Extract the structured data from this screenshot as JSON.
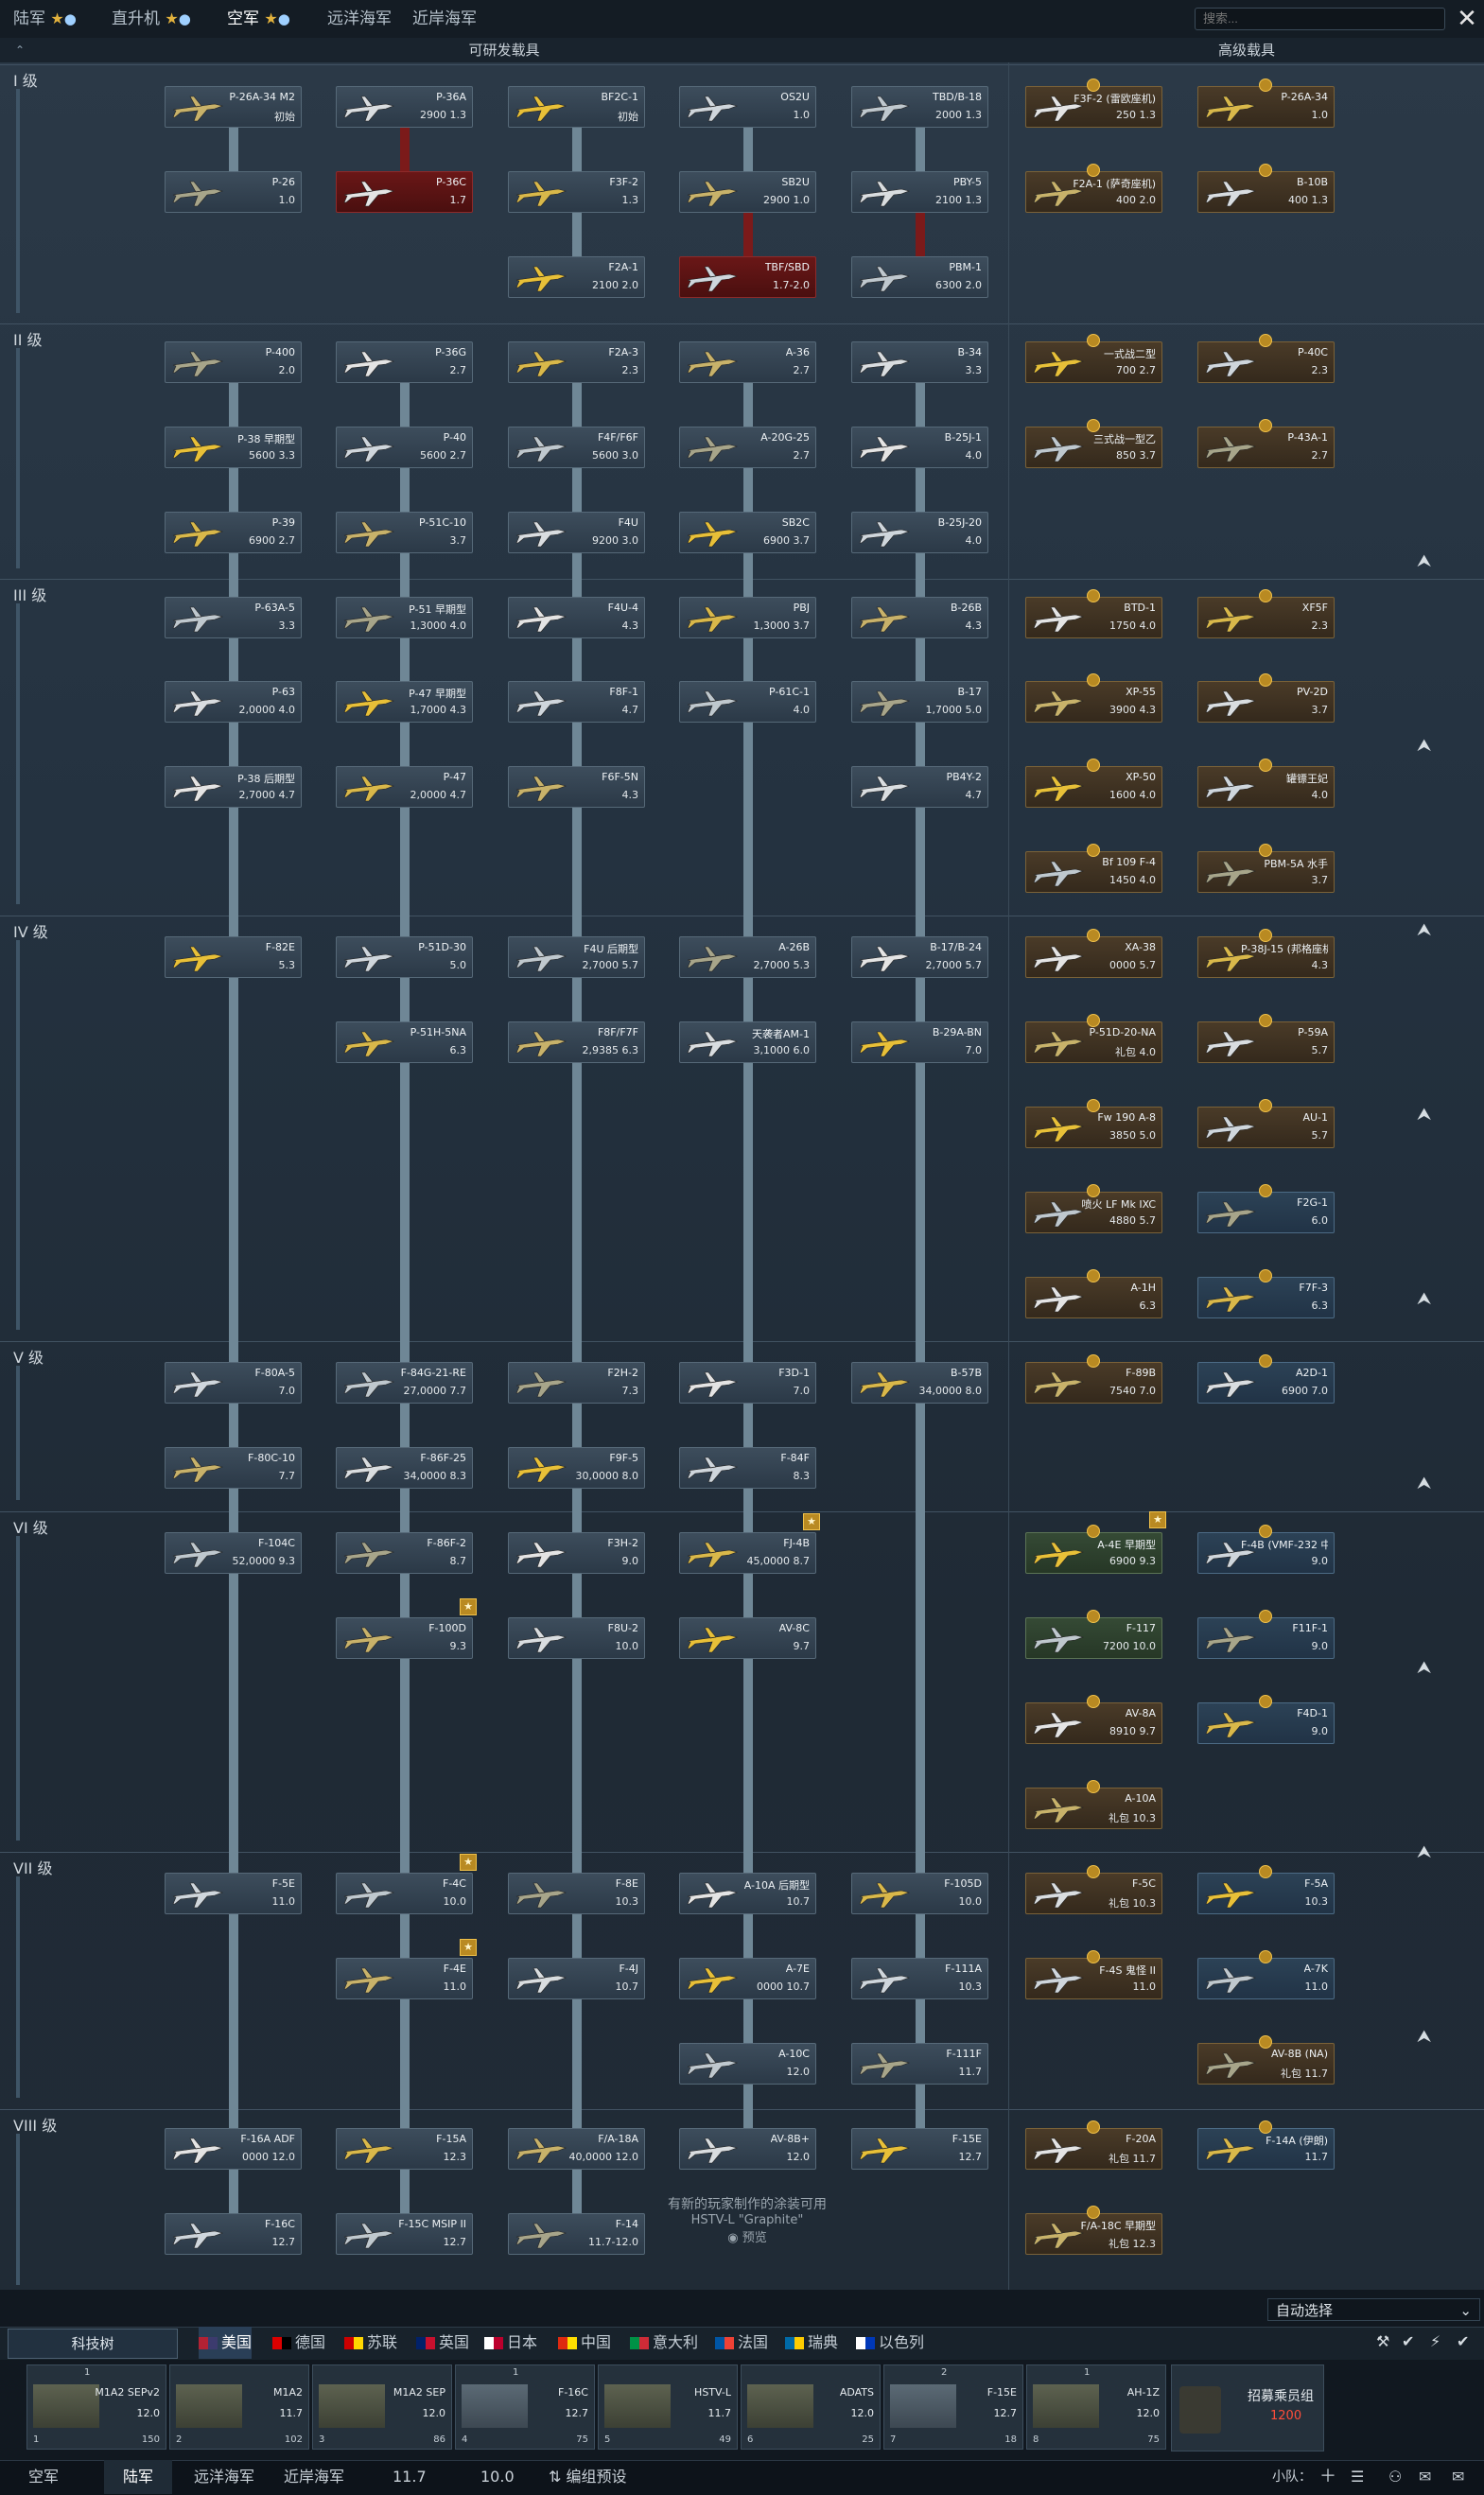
{
  "top_tabs": [
    {
      "label": "陆军",
      "stars": "★",
      "bulb": "💡"
    },
    {
      "label": "直升机",
      "stars": "★",
      "bulb": "💡"
    },
    {
      "label": "空军",
      "stars": "★",
      "bulb": "💡"
    },
    {
      "label": "远洋海军"
    },
    {
      "label": "近岸海军"
    }
  ],
  "search": {
    "placeholder": "搜索..."
  },
  "close_icon": "✕",
  "headers": {
    "researchable": "可研发载具",
    "premium": "高级载具"
  },
  "ranks": [
    "I 级",
    "II 级",
    "III 级",
    "IV 级",
    "V 级",
    "VI 级",
    "VII 级",
    "VIII 级"
  ],
  "vehicles": [
    {
      "name": "P-26A-34 M2",
      "br": "初始"
    },
    {
      "name": "P-36A",
      "br": "2900 1.3"
    },
    {
      "name": "BF2C-1",
      "br": "初始"
    },
    {
      "name": "OS2U",
      "br": "1.0"
    },
    {
      "name": "TBD/B-18",
      "br": "2000 1.3"
    },
    {
      "name": "P-26",
      "br": "1.0"
    },
    {
      "name": "P-36C",
      "br": "1.7"
    },
    {
      "name": "F3F-2",
      "br": "1.3"
    },
    {
      "name": "SB2U",
      "br": "2900 1.0"
    },
    {
      "name": "PBY-5",
      "br": "2100 1.3"
    },
    {
      "name": "F2A-1",
      "br": "2100 2.0"
    },
    {
      "name": "TBF/SBD",
      "br": "1.7-2.0"
    },
    {
      "name": "PBM-1",
      "br": "6300 2.0"
    },
    {
      "name": "P-400",
      "br": "2.0"
    },
    {
      "name": "P-36G",
      "br": "2.7"
    },
    {
      "name": "F2A-3",
      "br": "2.3"
    },
    {
      "name": "A-36",
      "br": "2.7"
    },
    {
      "name": "B-34",
      "br": "3.3"
    },
    {
      "name": "P-38 早期型",
      "br": "5600 3.3"
    },
    {
      "name": "P-40",
      "br": "5600 2.7"
    },
    {
      "name": "F4F/F6F",
      "br": "5600 3.0"
    },
    {
      "name": "A-20G-25",
      "br": "2.7"
    },
    {
      "name": "B-25J-1",
      "br": "4.0"
    },
    {
      "name": "P-39",
      "br": "6900 2.7"
    },
    {
      "name": "P-51C-10",
      "br": "3.7"
    },
    {
      "name": "F4U",
      "br": "9200 3.0"
    },
    {
      "name": "SB2C",
      "br": "6900 3.7"
    },
    {
      "name": "B-25J-20",
      "br": "4.0"
    },
    {
      "name": "P-63A-5",
      "br": "3.3"
    },
    {
      "name": "P-51 早期型",
      "br": "1,3000 4.0"
    },
    {
      "name": "F4U-4",
      "br": "4.3"
    },
    {
      "name": "PBJ",
      "br": "1,3000 3.7"
    },
    {
      "name": "B-26B",
      "br": "4.3"
    },
    {
      "name": "P-63",
      "br": "2,0000 4.0"
    },
    {
      "name": "P-47 早期型",
      "br": "1,7000 4.3"
    },
    {
      "name": "F8F-1",
      "br": "4.7"
    },
    {
      "name": "P-61C-1",
      "br": "4.0"
    },
    {
      "name": "B-17",
      "br": "1,7000 5.0"
    },
    {
      "name": "P-38 后期型",
      "br": "2,7000 4.7"
    },
    {
      "name": "P-47",
      "br": "2,0000 4.7"
    },
    {
      "name": "F6F-5N",
      "br": "4.3"
    },
    {
      "name": "PB4Y-2",
      "br": "4.7"
    },
    {
      "name": "F-82E",
      "br": "5.3"
    },
    {
      "name": "P-51D-30",
      "br": "5.0"
    },
    {
      "name": "F4U 后期型",
      "br": "2,7000 5.7"
    },
    {
      "name": "A-26B",
      "br": "2,7000 5.3"
    },
    {
      "name": "B-17/B-24",
      "br": "2,7000 5.7"
    },
    {
      "name": "P-51H-5NA",
      "br": "6.3"
    },
    {
      "name": "F8F/F7F",
      "br": "2,9385 6.3"
    },
    {
      "name": "天袭者AM-1",
      "br": "3,1000 6.0"
    },
    {
      "name": "B-29A-BN",
      "br": "7.0"
    },
    {
      "name": "F-80A-5",
      "br": "7.0"
    },
    {
      "name": "F-84G-21-RE",
      "br": "27,0000 7.7"
    },
    {
      "name": "F2H-2",
      "br": "7.3"
    },
    {
      "name": "F3D-1",
      "br": "7.0"
    },
    {
      "name": "B-57B",
      "br": "34,0000 8.0"
    },
    {
      "name": "F-80C-10",
      "br": "7.7"
    },
    {
      "name": "F-86F-25",
      "br": "34,0000 8.3"
    },
    {
      "name": "F9F-5",
      "br": "30,0000 8.0"
    },
    {
      "name": "F-84F",
      "br": "8.3"
    },
    {
      "name": "F-104C",
      "br": "52,0000 9.3"
    },
    {
      "name": "F-86F-2",
      "br": "8.7"
    },
    {
      "name": "F3H-2",
      "br": "9.0"
    },
    {
      "name": "FJ-4B",
      "br": "45,0000 8.7"
    },
    {
      "name": "F-100D",
      "br": "9.3"
    },
    {
      "name": "F8U-2",
      "br": "10.0"
    },
    {
      "name": "AV-8C",
      "br": "9.7"
    },
    {
      "name": "F-5E",
      "br": "11.0"
    },
    {
      "name": "F-4C",
      "br": "10.0"
    },
    {
      "name": "F-8E",
      "br": "10.3"
    },
    {
      "name": "A-10A 后期型",
      "br": "10.7"
    },
    {
      "name": "F-105D",
      "br": "10.0"
    },
    {
      "name": "F-4E",
      "br": "11.0"
    },
    {
      "name": "F-4J",
      "br": "10.7"
    },
    {
      "name": "A-7E",
      "br": "0000 10.7"
    },
    {
      "name": "F-111A",
      "br": "10.3"
    },
    {
      "name": "A-10C",
      "br": "12.0"
    },
    {
      "name": "F-111F",
      "br": "11.7"
    },
    {
      "name": "F-16A ADF",
      "br": "0000 12.0"
    },
    {
      "name": "F-15A",
      "br": "12.3"
    },
    {
      "name": "F/A-18A",
      "br": "40,0000 12.0"
    },
    {
      "name": "AV-8B+",
      "br": "12.0"
    },
    {
      "name": "F-15E",
      "br": "12.7"
    },
    {
      "name": "F-16C",
      "br": "12.7"
    },
    {
      "name": "F-15C MSIP II",
      "br": "12.7"
    },
    {
      "name": "F-14",
      "br": "11.7-12.0"
    },
    {
      "name": "F3F-2 (雷欧座机)",
      "br": "250 1.3"
    },
    {
      "name": "P-26A-34",
      "br": "1.0"
    },
    {
      "name": "F2A-1 (萨奇座机)",
      "br": "400 2.0"
    },
    {
      "name": "B-10B",
      "br": "400 1.3"
    },
    {
      "name": "一式战二型",
      "br": "700 2.7"
    },
    {
      "name": "P-40C",
      "br": "2.3"
    },
    {
      "name": "三式战一型乙",
      "br": "850 3.7"
    },
    {
      "name": "P-43A-1",
      "br": "2.7"
    },
    {
      "name": "BTD-1",
      "br": "1750 4.0"
    },
    {
      "name": "XF5F",
      "br": "2.3"
    },
    {
      "name": "XP-55",
      "br": "3900 4.3"
    },
    {
      "name": "PV-2D",
      "br": "3.7"
    },
    {
      "name": "XP-50",
      "br": "1600 4.0"
    },
    {
      "name": "罐镖王妃",
      "br": "4.0"
    },
    {
      "name": "Bf 109 F-4",
      "br": "1450 4.0"
    },
    {
      "name": "PBM-5A 水手",
      "br": "3.7"
    },
    {
      "name": "XA-38",
      "br": "0000 5.7"
    },
    {
      "name": "P-38J-15 (邦格座机)",
      "br": "4.3"
    },
    {
      "name": "P-51D-20-NA",
      "br": "礼包 4.0"
    },
    {
      "name": "P-59A",
      "br": "5.7"
    },
    {
      "name": "Fw 190 A-8",
      "br": "3850 5.0"
    },
    {
      "name": "AU-1",
      "br": "5.7"
    },
    {
      "name": "喷火 LF Mk IXC",
      "br": "4880 5.7"
    },
    {
      "name": "F2G-1",
      "br": "6.0"
    },
    {
      "name": "A-1H",
      "br": "6.3"
    },
    {
      "name": "F7F-3",
      "br": "6.3"
    },
    {
      "name": "F-89B",
      "br": "7540 7.0"
    },
    {
      "name": "A2D-1",
      "br": "6900 7.0"
    },
    {
      "name": "A-4E 早期型",
      "br": "6900 9.3"
    },
    {
      "name": "F-4B (VMF-232 中队)",
      "br": "9.0"
    },
    {
      "name": "F-117",
      "br": "7200 10.0"
    },
    {
      "name": "F11F-1",
      "br": "9.0"
    },
    {
      "name": "AV-8A",
      "br": "8910 9.7"
    },
    {
      "name": "F4D-1",
      "br": "9.0"
    },
    {
      "name": "A-10A",
      "br": "礼包 10.3"
    },
    {
      "name": "F-5C",
      "br": "礼包 10.3"
    },
    {
      "name": "F-5A",
      "br": "10.3"
    },
    {
      "name": "F-4S 鬼怪 II",
      "br": "11.0"
    },
    {
      "name": "A-7K",
      "br": "11.0"
    },
    {
      "name": "AV-8B (NA)",
      "br": "礼包 11.7"
    },
    {
      "name": "F-20A",
      "br": "礼包 11.7"
    },
    {
      "name": "F-14A (伊朗)",
      "br": "11.7"
    },
    {
      "name": "F/A-18C 早期型",
      "br": "礼包 12.3"
    }
  ],
  "notice": {
    "line1": "有新的玩家制作的涂装可用",
    "line2": "HSTV-L \"Graphite\"",
    "line3": "预览"
  },
  "auto_select": "自动选择",
  "tech_tree": "科技树",
  "nations": [
    "美国",
    "德国",
    "苏联",
    "英国",
    "日本",
    "中国",
    "意大利",
    "法国",
    "瑞典",
    "以色列"
  ],
  "crew": [
    {
      "name": "M1A2 SEPv2",
      "br": "12.0",
      "slot": "1",
      "val": "150"
    },
    {
      "name": "M1A2",
      "br": "11.7",
      "slot": "2",
      "val": "102"
    },
    {
      "name": "M1A2 SEP",
      "br": "12.0",
      "slot": "3",
      "val": "86"
    },
    {
      "name": "F-16C",
      "br": "12.7",
      "slot": "4",
      "val": "75"
    },
    {
      "name": "HSTV-L",
      "br": "11.7",
      "slot": "5",
      "val": "49"
    },
    {
      "name": "ADATS",
      "br": "12.0",
      "slot": "6",
      "val": "25"
    },
    {
      "name": "F-15E",
      "br": "12.7",
      "slot": "7",
      "val": "18"
    },
    {
      "name": "AH-1Z",
      "br": "12.0",
      "slot": "8",
      "val": "75"
    }
  ],
  "crew_top": [
    "1",
    "",
    "",
    "1",
    "",
    "",
    "2",
    "1"
  ],
  "recruit": {
    "label": "招募乘员组",
    "cost": "1200"
  },
  "bottom_tabs": [
    "空军",
    "陆军",
    "远洋海军",
    "近岸海军",
    "11.7",
    "10.0",
    "编组预设",
    "小队："
  ],
  "colors": {
    "accent": "#d33",
    "premium": "#7a6238",
    "squadron": "#4c6b85",
    "locked": "#6a1717",
    "cost": "#ff4d3a"
  }
}
